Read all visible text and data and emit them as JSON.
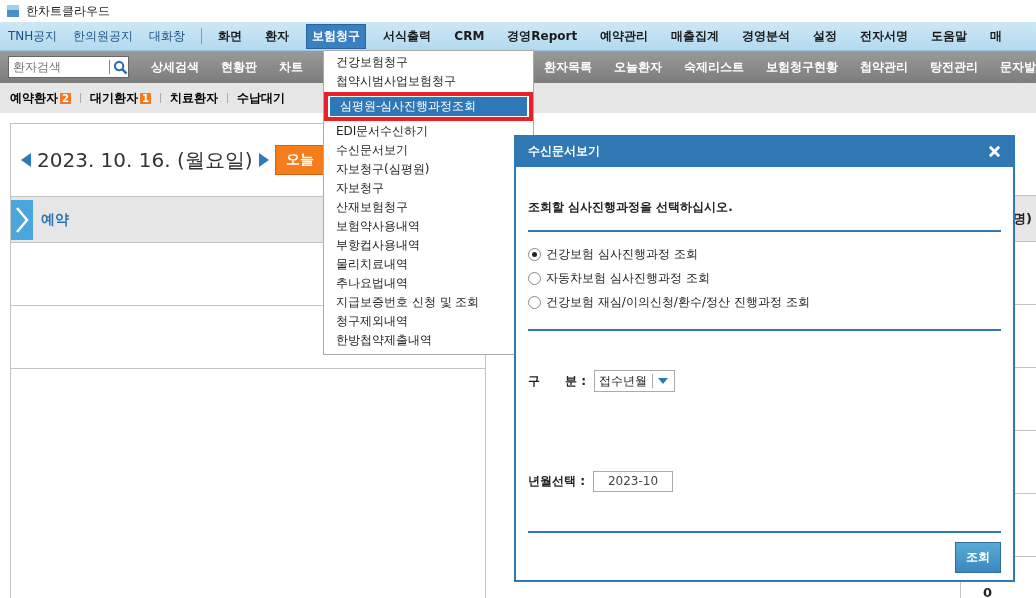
{
  "window": {
    "title": "한차트클라우드"
  },
  "notice_links": [
    "TNH공지",
    "한의원공지",
    "대화창"
  ],
  "top_menu": [
    {
      "label": "화면",
      "selected": false
    },
    {
      "label": "환자",
      "selected": false
    },
    {
      "label": "보험청구",
      "selected": true
    },
    {
      "label": "서식출력",
      "selected": false
    },
    {
      "label": "CRM",
      "selected": false
    },
    {
      "label": "경영Report",
      "selected": false
    },
    {
      "label": "예약관리",
      "selected": false
    },
    {
      "label": "매출집계",
      "selected": false
    },
    {
      "label": "경영분석",
      "selected": false
    },
    {
      "label": "설정",
      "selected": false
    },
    {
      "label": "전자서명",
      "selected": false
    },
    {
      "label": "도움말",
      "selected": false
    },
    {
      "label": "매",
      "selected": false
    }
  ],
  "toolbar": {
    "search": {
      "placeholder": "환자검색"
    },
    "items_left": [
      "상세검색",
      "현황판",
      "차트"
    ],
    "items_right": [
      "환자목록",
      "오늘환자",
      "숙제리스트",
      "보험청구현황",
      "첩약관리",
      "탕전관리",
      "문자발"
    ]
  },
  "patient_tabs": [
    {
      "label": "예약환자",
      "count": "2"
    },
    {
      "label": "대기환자",
      "count": "1"
    },
    {
      "label": "치료환자"
    },
    {
      "label": "수납대기"
    }
  ],
  "schedule": {
    "date": "2023. 10. 16. (월요일)",
    "today_button": "오늘",
    "section": "예약"
  },
  "right_panel": {
    "header": "명)",
    "cell": "0"
  },
  "dropdown": [
    {
      "label": "건강보험청구",
      "selected": false
    },
    {
      "label": "첩약시범사업보험청구",
      "selected": false
    },
    {
      "label": "심평원-심사진행과정조회",
      "selected": true
    },
    {
      "label": "EDI문서수신하기",
      "selected": false
    },
    {
      "label": "수신문서보기",
      "selected": false
    },
    {
      "label": "자보청구(심평원)",
      "selected": false
    },
    {
      "label": "자보청구",
      "selected": false
    },
    {
      "label": "산재보험청구",
      "selected": false
    },
    {
      "label": "보험약사용내역",
      "selected": false
    },
    {
      "label": "부항컵사용내역",
      "selected": false
    },
    {
      "label": "물리치료내역",
      "selected": false
    },
    {
      "label": "추나요법내역",
      "selected": false
    },
    {
      "label": "지급보증번호 신청 및 조회",
      "selected": false
    },
    {
      "label": "청구제외내역",
      "selected": false
    },
    {
      "label": "한방첩약제출내역",
      "selected": false
    }
  ],
  "dialog": {
    "title": "수신문서보기",
    "prompt": "조회할 심사진행과정을 선택하십시오.",
    "options": [
      {
        "label": "건강보험 심사진행과정 조회",
        "selected": true
      },
      {
        "label": "자동차보험 심사진행과정 조회",
        "selected": false
      },
      {
        "label": "건강보험 재심/이의신청/환수/정산 진행과정 조회",
        "selected": false
      }
    ],
    "fields": [
      {
        "kind": "select",
        "label": "구      분 :",
        "value": "접수년월"
      },
      {
        "kind": "input",
        "label": "년월선택 :",
        "value": "2023-10"
      }
    ],
    "button": "조회"
  }
}
